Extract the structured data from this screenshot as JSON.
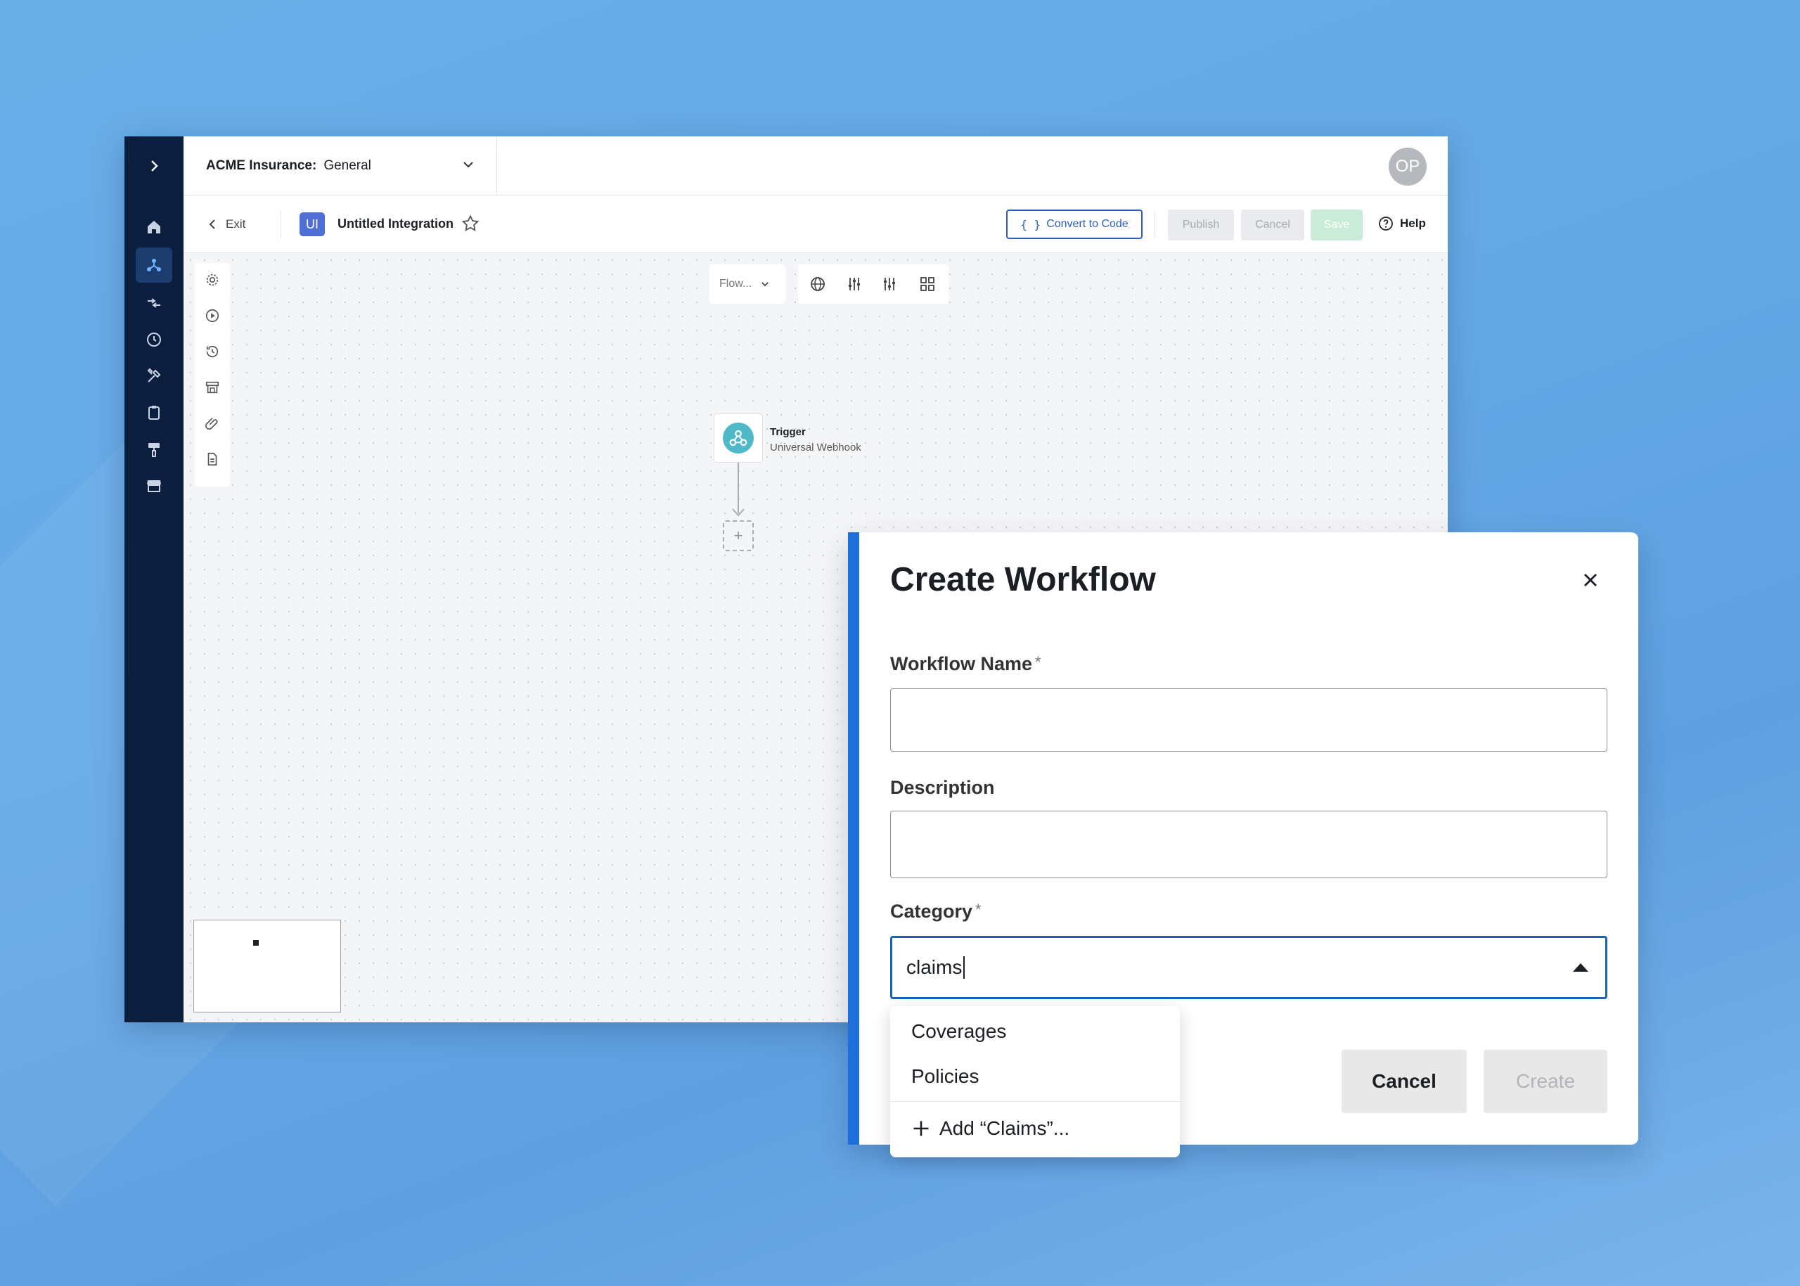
{
  "topbar": {
    "org_label": "ACME Insurance:",
    "workspace": "General",
    "avatar_initials": "OP"
  },
  "toolbar": {
    "exit_label": "Exit",
    "integration_badge": "UI",
    "integration_title": "Untitled Integration",
    "convert_label": "Convert to Code",
    "publish_label": "Publish",
    "cancel_label": "Cancel",
    "save_label": "Save",
    "help_label": "Help"
  },
  "sidebar": {
    "items": [
      {
        "icon": "home-icon"
      },
      {
        "icon": "integrations-icon",
        "active": true
      },
      {
        "icon": "connections-icon"
      },
      {
        "icon": "history-icon"
      },
      {
        "icon": "tools-icon"
      },
      {
        "icon": "clipboard-icon"
      },
      {
        "icon": "paint-roller-icon"
      },
      {
        "icon": "store-icon"
      }
    ]
  },
  "canvas": {
    "view_select": "Flow...",
    "trigger_title": "Trigger",
    "trigger_subtitle": "Universal Webhook"
  },
  "modal": {
    "title": "Create Workflow",
    "workflow_name_label": "Workflow Name",
    "workflow_name_value": "",
    "description_label": "Description",
    "description_value": "",
    "category_label": "Category",
    "required_mark": "*",
    "category_value": "claims",
    "cancel_label": "Cancel",
    "create_label": "Create",
    "accent_color": "#1e6fd9"
  },
  "dropdown": {
    "options": [
      "Coverages",
      "Policies"
    ],
    "add_label": "Add “Claims”..."
  }
}
